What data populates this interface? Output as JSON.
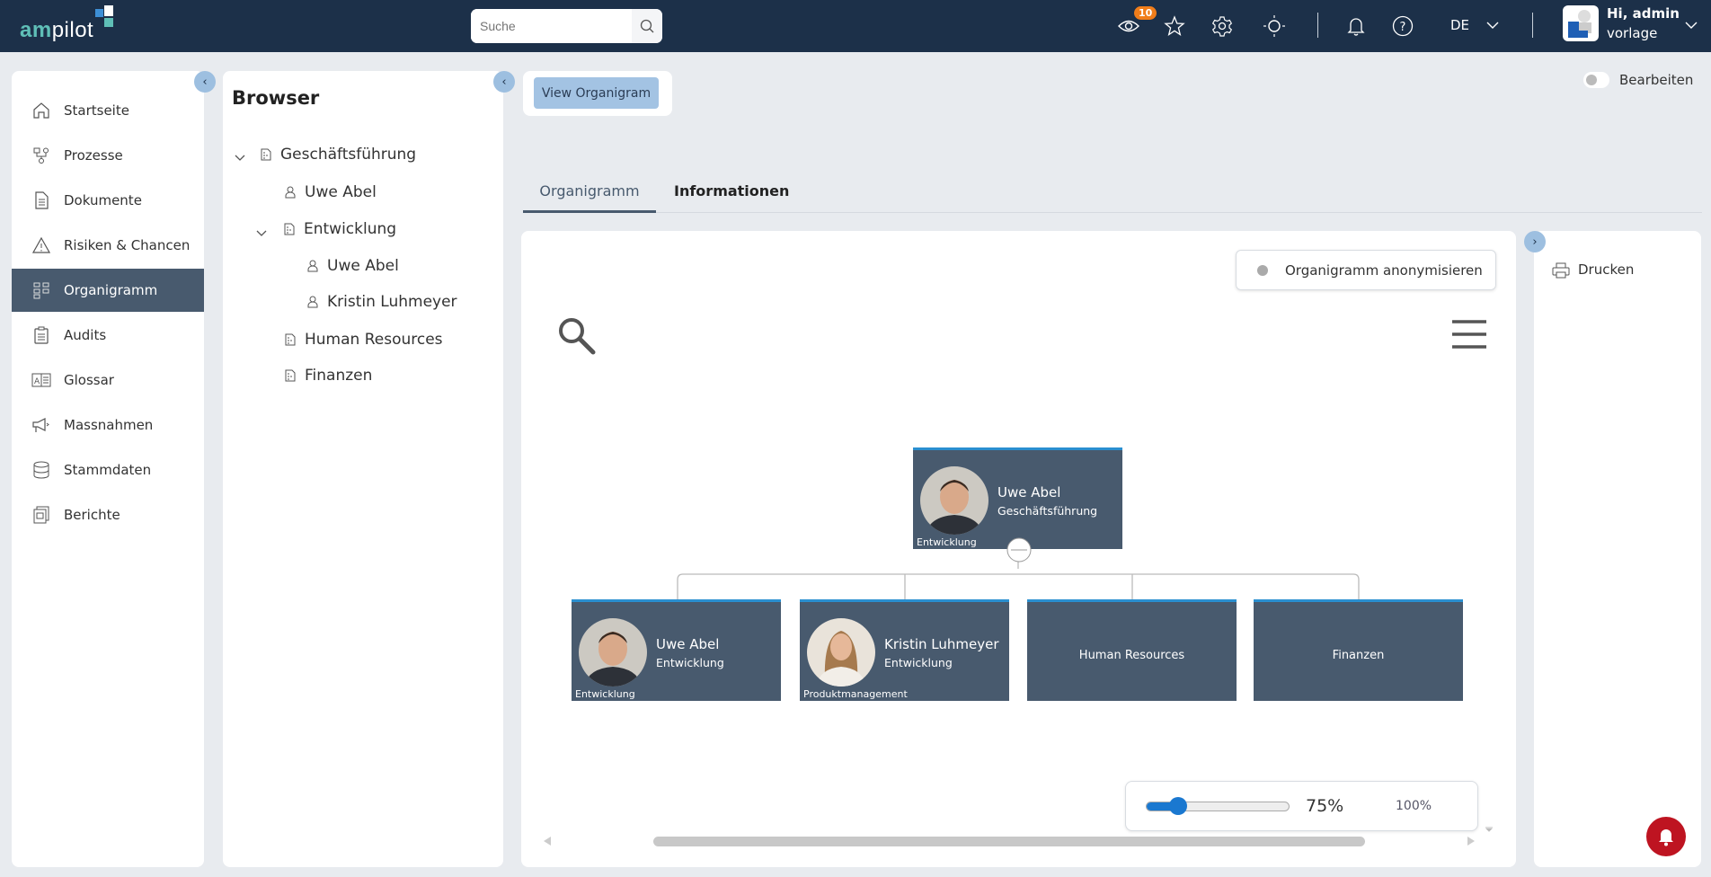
{
  "header": {
    "logo_text": "ampilot",
    "search_placeholder": "Suche",
    "watch_badge": "10",
    "language": "DE",
    "user_greeting": "Hi, admin",
    "user_name": "vorlage"
  },
  "sidebar": {
    "items": [
      {
        "label": "Startseite",
        "icon": "home-icon"
      },
      {
        "label": "Prozesse",
        "icon": "process-icon"
      },
      {
        "label": "Dokumente",
        "icon": "document-icon"
      },
      {
        "label": "Risiken & Chancen",
        "icon": "warning-icon"
      },
      {
        "label": "Organigramm",
        "icon": "org-chart-icon",
        "active": true
      },
      {
        "label": "Audits",
        "icon": "clipboard-icon"
      },
      {
        "label": "Glossar",
        "icon": "glossary-icon"
      },
      {
        "label": "Massnahmen",
        "icon": "megaphone-icon"
      },
      {
        "label": "Stammdaten",
        "icon": "database-icon"
      },
      {
        "label": "Berichte",
        "icon": "reports-icon"
      }
    ]
  },
  "browser": {
    "title": "Browser",
    "tree": [
      {
        "label": "Geschäftsführung",
        "type": "unit",
        "expanded": true
      },
      {
        "label": "Uwe Abel",
        "type": "person"
      },
      {
        "label": "Entwicklung",
        "type": "unit",
        "expanded": true
      },
      {
        "label": "Uwe Abel",
        "type": "person"
      },
      {
        "label": "Kristin Luhmeyer",
        "type": "person"
      },
      {
        "label": "Human Resources",
        "type": "unit"
      },
      {
        "label": "Finanzen",
        "type": "unit"
      }
    ]
  },
  "toolbar": {
    "view_button": "View Organigram",
    "edit_toggle_label": "Bearbeiten"
  },
  "tabs": [
    {
      "label": "Organigramm",
      "active": true
    },
    {
      "label": "Informationen"
    }
  ],
  "chart": {
    "anonymize_label": "Organigramm anonymisieren",
    "root": {
      "name": "Uwe Abel",
      "role": "Geschäftsführung",
      "unit": "Entwicklung"
    },
    "children": [
      {
        "name": "Uwe Abel",
        "role": "Entwicklung",
        "unit": "Entwicklung"
      },
      {
        "name": "Kristin Luhmeyer",
        "role": "Entwicklung",
        "unit": "Produktmanagement"
      },
      {
        "name": "Human Resources"
      },
      {
        "name": "Finanzen"
      }
    ],
    "zoom": {
      "current": "75%",
      "reset": "100%",
      "level_percent": 75
    }
  },
  "right_panel": {
    "print_label": "Drucken"
  },
  "colors": {
    "header": "#1c3049",
    "active_nav": "#485a6e",
    "node_bg": "#485a6e",
    "accent": "#2a8fd0",
    "alert": "#be1421"
  }
}
